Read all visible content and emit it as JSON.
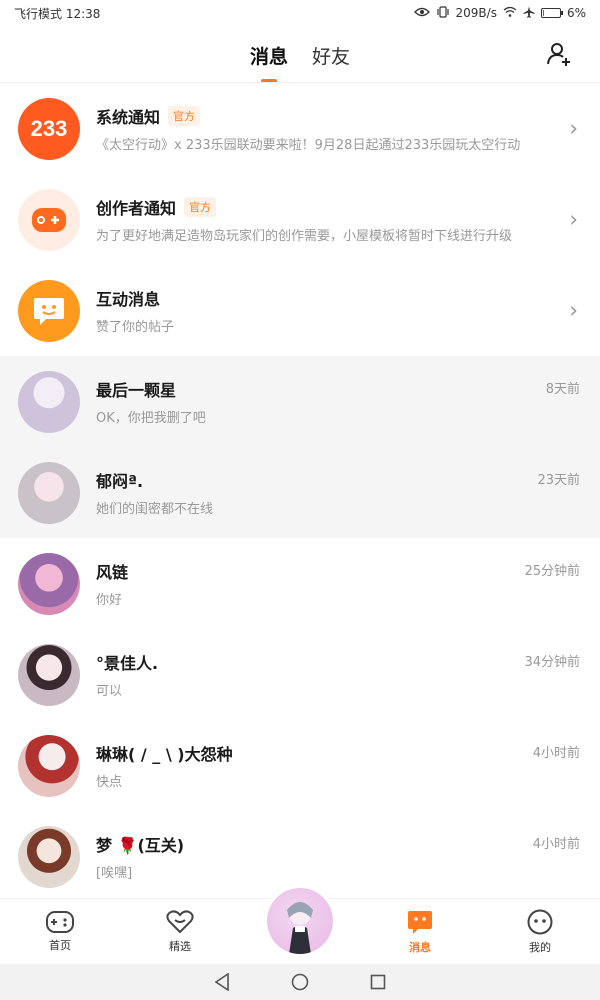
{
  "status_bar": {
    "left": "飞行模式 12:38",
    "net_speed": "209B/s",
    "battery": "6%",
    "battery_level": 0.06
  },
  "header": {
    "tabs": [
      {
        "label": "消息",
        "active": true
      },
      {
        "label": "好友",
        "active": false
      }
    ]
  },
  "notifications": [
    {
      "title": "系统通知",
      "badge": "官方",
      "subtitle": "《太空行动》x 233乐园联动要来啦！9月28日起通过233乐园玩太空行动",
      "icon": "logo-233",
      "avatar_text": "233"
    },
    {
      "title": "创作者通知",
      "badge": "官方",
      "subtitle": "为了更好地满足造物岛玩家们的创作需要，小屋模板将暂时下线进行升级",
      "icon": "gamepad-icon"
    },
    {
      "title": "互动消息",
      "badge": "",
      "subtitle": "赞了你的帖子",
      "icon": "chat-smile-icon"
    }
  ],
  "conversations": [
    {
      "name": "最后一颗星",
      "message": "OK，你把我删了吧",
      "time": "8天前",
      "shaded": true,
      "color": "#cfc3dc"
    },
    {
      "name": "郁闷ª.",
      "message": "她们的闺密都不在线",
      "time": "23天前",
      "shaded": true,
      "color": "#d9cbd6"
    },
    {
      "name": "风链",
      "message": "你好",
      "time": "25分钟前",
      "shaded": false,
      "color": "#d88ab5"
    },
    {
      "name": "°景佳人.",
      "message": "可以",
      "time": "34分钟前",
      "shaded": false,
      "color": "#c9b9c2"
    },
    {
      "name": "琳琳( / _ \\ )大怨种",
      "message": "快点",
      "time": "4小时前",
      "shaded": false,
      "color": "#e7c3c0"
    },
    {
      "name": "梦 🌹(互关)",
      "message": "[唉嘿]",
      "time": "4小时前",
      "shaded": false,
      "color": "#e2d8cf"
    }
  ],
  "bottom_nav": [
    {
      "label": "首页",
      "icon": "gamepad-icon",
      "active": false
    },
    {
      "label": "精选",
      "icon": "heart-icon",
      "active": false
    },
    {
      "label": "消息",
      "icon": "chat-icon",
      "active": true
    },
    {
      "label": "我的",
      "icon": "face-icon",
      "active": false
    }
  ],
  "colors": {
    "accent": "#ff7a1f",
    "text_secondary": "#999999"
  }
}
